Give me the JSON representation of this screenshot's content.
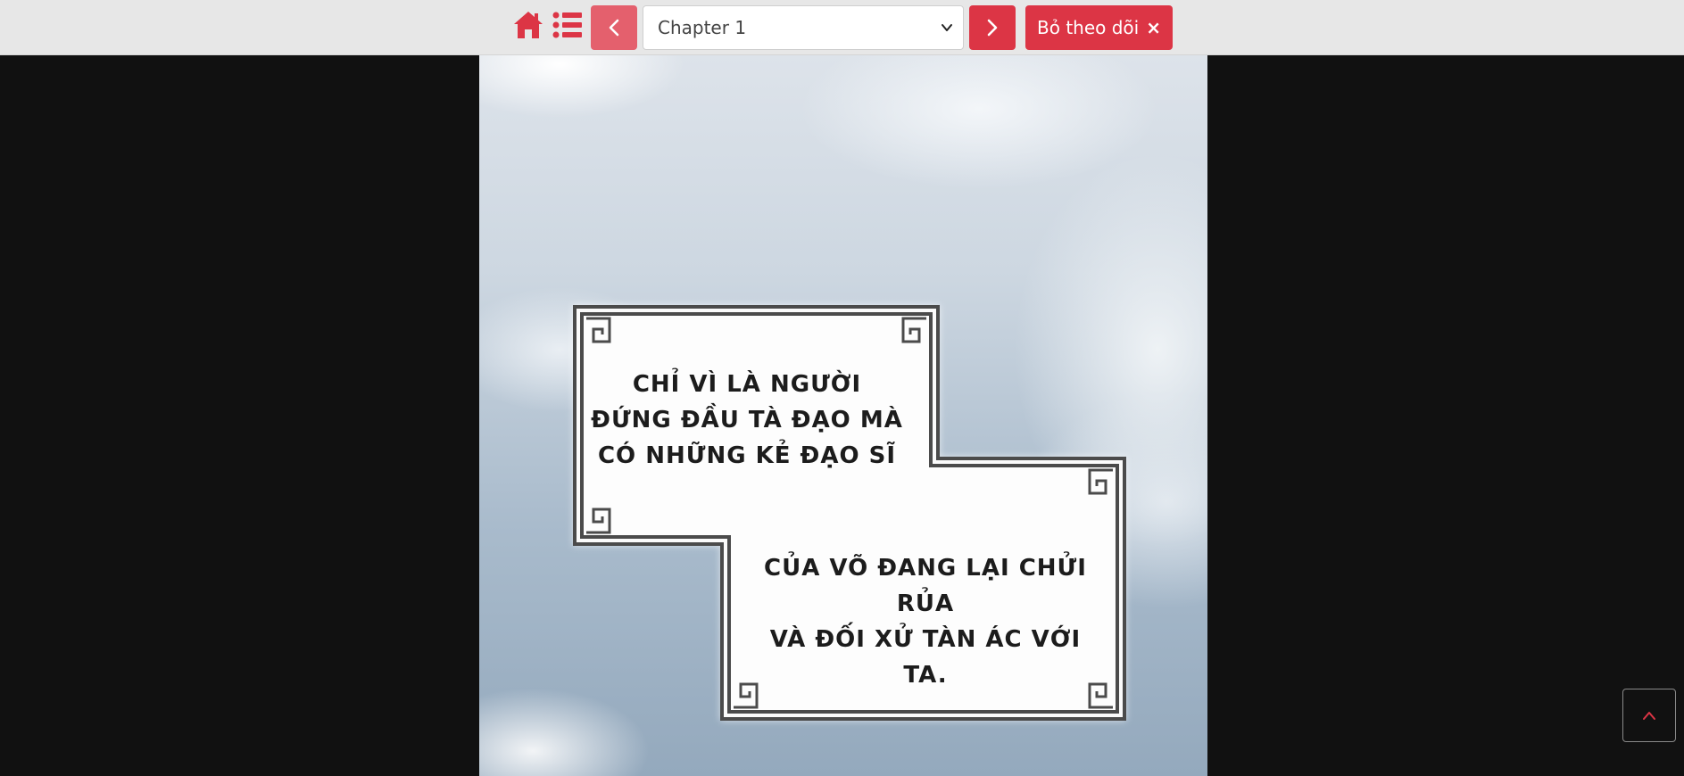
{
  "topbar": {
    "home_icon": "home-icon",
    "list_icon": "list-icon",
    "prev_icon": "chevron-left-icon",
    "next_icon": "chevron-right-icon",
    "chapter_select": {
      "selected": "Chapter 1"
    },
    "unfollow_label": "Bỏ theo dõi",
    "unfollow_close": "×"
  },
  "comic": {
    "caption_1": [
      "CHỈ VÌ LÀ NGƯỜI",
      "ĐỨNG ĐẦU TÀ ĐẠO MÀ",
      "CÓ NHỮNG KẺ ĐẠO SĨ"
    ],
    "caption_2": [
      "CỦA VÕ ĐANG LẠI CHỬI RỦA",
      "VÀ ĐỐI XỬ TÀN ÁC VỚI TA."
    ]
  },
  "scroll_top_icon": "chevron-up-icon",
  "colors": {
    "accent": "#dc3545",
    "accent_light": "#e4606d",
    "topbar_bg": "#e7e7e7",
    "page_bg": "#111111"
  }
}
